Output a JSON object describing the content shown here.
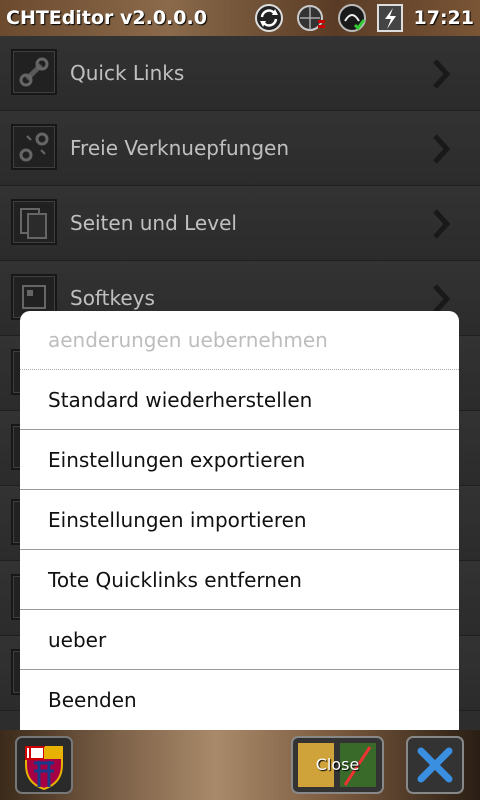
{
  "statusbar": {
    "app_title": "CHTEditor v2.0.0.0",
    "clock": "17:21",
    "icons": [
      "sync-icon",
      "globe-icon",
      "signal-icon",
      "battery-icon"
    ]
  },
  "list": {
    "items": [
      {
        "label": "Quick Links",
        "icon": "link-icon"
      },
      {
        "label": "Freie Verknuepfungen",
        "icon": "broken-link-icon"
      },
      {
        "label": "Seiten und Level",
        "icon": "pages-icon"
      },
      {
        "label": "Softkeys",
        "icon": "softkey-icon"
      }
    ]
  },
  "menu": {
    "items": [
      {
        "label": "aenderungen uebernehmen",
        "enabled": false
      },
      {
        "label": "Standard wiederherstellen",
        "enabled": true
      },
      {
        "label": "Einstellungen exportieren",
        "enabled": true
      },
      {
        "label": "Einstellungen importieren",
        "enabled": true
      },
      {
        "label": "Tote Quicklinks entfernen",
        "enabled": true
      },
      {
        "label": "ueber",
        "enabled": true
      },
      {
        "label": "Beenden",
        "enabled": true
      }
    ]
  },
  "bottombar": {
    "close_label": "Close",
    "left_icon": "fcb-crest-icon",
    "right_icon": "tools-icon"
  }
}
